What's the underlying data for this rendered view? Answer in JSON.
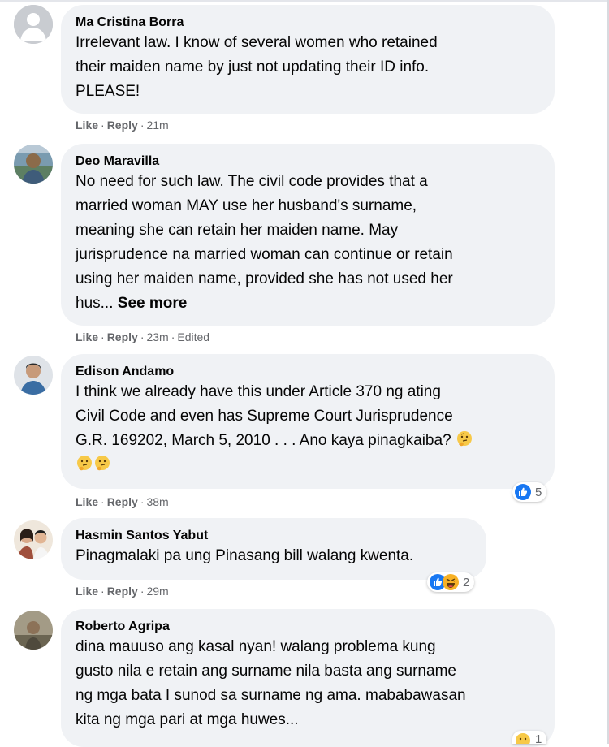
{
  "comments": [
    {
      "author": "Ma Cristina Borra",
      "lines": [
        "Irrelevant law. I know of several women who retained",
        "their maiden name by just not updating their ID info.",
        "PLEASE!"
      ],
      "like": "Like",
      "reply": "Reply",
      "time": "21m"
    },
    {
      "author": "Deo Maravilla",
      "lines": [
        "No need for such law. The civil code provides that a",
        "married woman MAY use her husband's surname,",
        "meaning she can retain her maiden name. May",
        "jurisprudence na married woman can continue or retain",
        "using her maiden name, provided she has not used her"
      ],
      "last_line": "hus...",
      "see_more": "See more",
      "like": "Like",
      "reply": "Reply",
      "time": "23m",
      "edited": "Edited"
    },
    {
      "author": "Edison Andamo",
      "lines": [
        "I think we already have this under Article 370 ng ating",
        "Civil Code and even has Supreme Court Jurisprudence",
        "G.R. 169202, March 5, 2010 . . . Ano kaya pinagkaiba?"
      ],
      "like": "Like",
      "reply": "Reply",
      "time": "38m",
      "reaction_count": "5",
      "emoji": "thinking-face"
    },
    {
      "author": "Hasmin Santos Yabut",
      "lines": [
        "Pinagmalaki pa ung Pinasang bill walang kwenta."
      ],
      "like": "Like",
      "reply": "Reply",
      "time": "29m",
      "reaction_count": "2"
    },
    {
      "author": "Roberto Agripa",
      "lines": [
        "dina mauuso ang kasal nyan! walang problema kung",
        "gusto nila e retain ang surname nila basta ang surname",
        "ng mga bata I sunod sa surname ng ama. mababawasan",
        "kita ng mga pari at mga huwes..."
      ],
      "reaction_count": "1"
    }
  ],
  "colors": {
    "bubble": "#f0f2f5",
    "meta": "#65676b",
    "like_blue": "#1877f2",
    "haha_yellow": "#f7b125"
  }
}
